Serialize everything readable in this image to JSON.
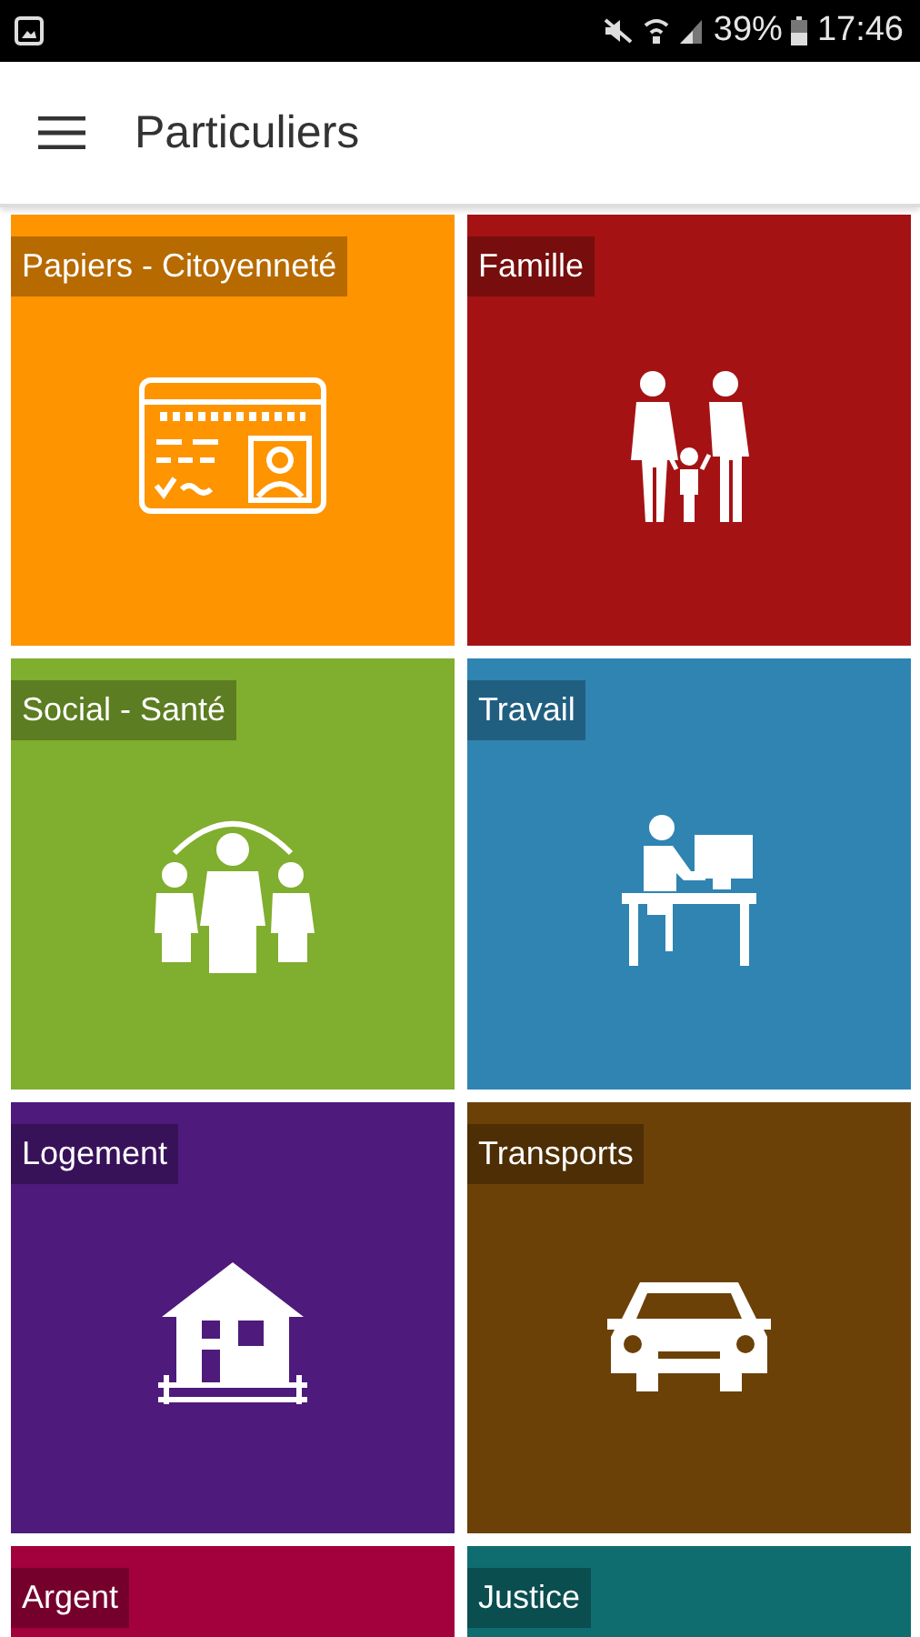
{
  "status_bar": {
    "battery": "39%",
    "time": "17:46"
  },
  "app_bar": {
    "title": "Particuliers"
  },
  "tiles": [
    {
      "label": "Papiers - Citoyenneté",
      "color": "#fe9400"
    },
    {
      "label": "Famille",
      "color": "#a51213"
    },
    {
      "label": "Social - Santé",
      "color": "#80ae2e"
    },
    {
      "label": "Travail",
      "color": "#2f84b2"
    },
    {
      "label": "Logement",
      "color": "#4e1a7c"
    },
    {
      "label": "Transports",
      "color": "#6b4108"
    },
    {
      "label": "Argent",
      "color": "#a3003e"
    },
    {
      "label": "Justice",
      "color": "#0f6d70"
    }
  ]
}
